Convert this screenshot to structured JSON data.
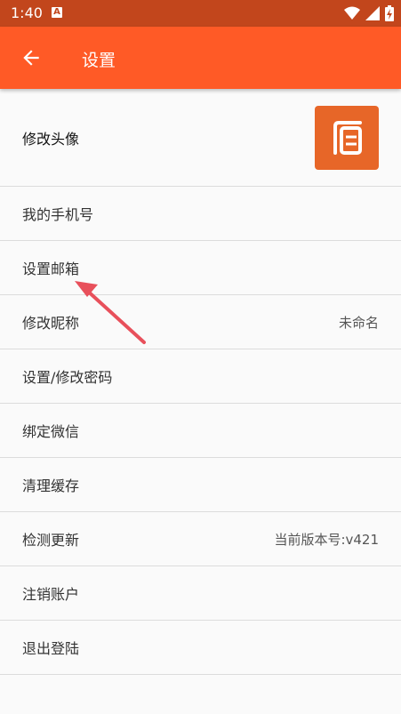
{
  "status_bar": {
    "time": "1:40",
    "notification_icon": "a-app-icon",
    "icons": [
      "wifi-icon",
      "signal-icon",
      "battery-charging-icon"
    ]
  },
  "app_bar": {
    "title": "设置",
    "back_icon": "arrow-left-icon",
    "color": "#ff5a26"
  },
  "settings": {
    "avatar_label": "修改头像",
    "phone_label": "我的手机号",
    "email_label": "设置邮箱",
    "nickname_label": "修改昵称",
    "nickname_value": "未命名",
    "password_label": "设置/修改密码",
    "wechat_label": "绑定微信",
    "cache_label": "清理缓存",
    "update_label": "检测更新",
    "update_value": "当前版本号:v421",
    "deactivate_label": "注销账户",
    "logout_label": "退出登陆"
  },
  "colors": {
    "status_bar": "#c2461c",
    "avatar_bg": "#e76628",
    "annotation_arrow": "#e8505b"
  }
}
